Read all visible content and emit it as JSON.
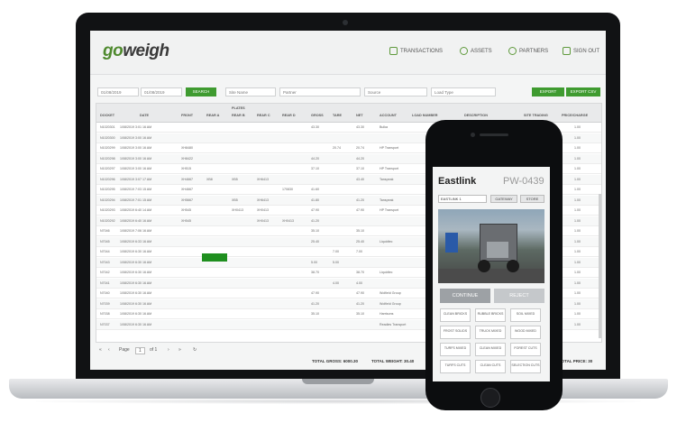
{
  "app": {
    "logo_go": "go",
    "logo_weigh": "weigh",
    "nav": [
      {
        "label": "TRANSACTIONS",
        "icon": "chart-icon"
      },
      {
        "label": "ASSETS",
        "icon": "assets-icon"
      },
      {
        "label": "PARTNERS",
        "icon": "partners-icon"
      },
      {
        "label": "SIGN OUT",
        "icon": "signout-icon"
      }
    ]
  },
  "filters": {
    "date_from": "01/08/2019",
    "date_to": "01/08/2019",
    "search_button": "SEARCH",
    "select1": "Site Name",
    "select2": "Partner",
    "select3": "Source",
    "select4": "Load Type",
    "export_button": "EXPORT",
    "export_csv_button": "EXPORT CSV"
  },
  "table": {
    "group_header": "PLATES",
    "columns": [
      "DOCKET",
      "DATE",
      "FRONT",
      "REAR A",
      "REAR B",
      "REAR C",
      "REAR D",
      "GROSS",
      "TARE",
      "NET",
      "ACCOUNT",
      "LOAD NUMBER",
      "DESCRIPTION",
      "SITE TRADING",
      "PRICE/CHARGE"
    ],
    "rows": [
      [
        "N1020301",
        "1/08/2019 3:01 16 AM",
        "",
        "",
        "",
        "",
        "",
        "43.30",
        "",
        "43.30",
        "Bulka",
        "",
        "",
        "",
        "1.00"
      ],
      [
        "N1020300",
        "1/08/2019 3:00 16 AM",
        "",
        "",
        "",
        "",
        "",
        "",
        "",
        "",
        "",
        "",
        "",
        "",
        "1.00"
      ],
      [
        "N1020299",
        "1/08/2019 3:00 16 AM",
        "XH8480",
        "",
        "",
        "",
        "",
        "",
        "20.74",
        "20.74",
        "HP Transport",
        "",
        "",
        "",
        "1.00"
      ],
      [
        "N1020298",
        "1/08/2019 3:00 16 AM",
        "XH8422",
        "",
        "",
        "",
        "",
        "44.20",
        "",
        "44.20",
        "",
        "",
        "",
        "",
        "1.00"
      ],
      [
        "N1020297",
        "1/08/2019 3:00 16 AM",
        "XH515",
        "",
        "",
        "",
        "",
        "37.10",
        "",
        "37.10",
        "HP Transport",
        "",
        "",
        "",
        "1.00"
      ],
      [
        "N1020296",
        "1/08/2019 3:07 17 AM",
        "XH4667",
        "XB8",
        "XB5",
        "XH6413",
        "",
        "",
        "",
        "43.40",
        "Tanspeak",
        "",
        "",
        "",
        "1.00"
      ],
      [
        "N1020295",
        "1/08/2019 7:03 15 AM",
        "XH4667",
        "",
        "",
        "",
        "170830",
        "41.60",
        "",
        "",
        "",
        "",
        "",
        "",
        "1.00"
      ],
      [
        "N1020294",
        "1/08/2019 7:01 15 AM",
        "XH5667",
        "",
        "XB5",
        "XH6413",
        "",
        "41.80",
        "",
        "41.20",
        "Tanspeak",
        "",
        "",
        "",
        "1.00"
      ],
      [
        "N1020293",
        "1/08/2019 6:40 14 AM",
        "XH545",
        "",
        "XH0413",
        "XH0413",
        "",
        "47.90",
        "",
        "47.90",
        "HP Transport",
        "",
        "",
        "",
        "1.00"
      ],
      [
        "N1020292",
        "1/08/2019 6:40 16 AM",
        "XH545",
        "",
        "",
        "XH0413",
        "XH0413",
        "41.20",
        "",
        "",
        "",
        "",
        "",
        "",
        "1.00"
      ],
      [
        "N7046",
        "1/08/2019 7:06 16 AM",
        "",
        "",
        "",
        "",
        "",
        "35.10",
        "",
        "35.10",
        "",
        "",
        "",
        "",
        "1.00"
      ],
      [
        "N7045",
        "1/08/2019 6:33 16 AM",
        "",
        "",
        "",
        "",
        "",
        "25.40",
        "",
        "25.40",
        "Liquidtec",
        "",
        "",
        "",
        "1.00"
      ],
      [
        "N7044",
        "1/08/2019 6:30 16 AM",
        "",
        "",
        "",
        "",
        "",
        "",
        "7.00",
        "7.00",
        "",
        "",
        "",
        "",
        "1.00"
      ],
      [
        "N7043",
        "1/08/2019 6:30 16 AM",
        "",
        "",
        "",
        "",
        "",
        "5.00",
        "5.00",
        "",
        "",
        "",
        "",
        "",
        "1.00"
      ],
      [
        "N7042",
        "1/08/2019 6:30 16 AM",
        "",
        "",
        "",
        "",
        "",
        "38.70",
        "",
        "38.70",
        "Liquidtec",
        "",
        "",
        "",
        "1.00"
      ],
      [
        "N7041",
        "1/08/2019 6:30 16 AM",
        "",
        "",
        "",
        "",
        "",
        "",
        "4.00",
        "4.00",
        "",
        "",
        "",
        "",
        "1.00"
      ],
      [
        "N7040",
        "1/08/2019 6:30 16 AM",
        "",
        "",
        "",
        "",
        "",
        "47.90",
        "",
        "47.90",
        "Wolfield Group",
        "",
        "",
        "",
        "1.00"
      ],
      [
        "N7039",
        "1/08/2019 6:30 16 AM",
        "",
        "",
        "",
        "",
        "",
        "41.20",
        "",
        "41.20",
        "Wolfield Group",
        "",
        "",
        "",
        "1.00"
      ],
      [
        "N7038",
        "1/08/2019 6:30 16 AM",
        "",
        "",
        "",
        "",
        "",
        "35.10",
        "",
        "35.10",
        "Harrisons",
        "",
        "",
        "",
        "1.00"
      ],
      [
        "N7037",
        "1/08/2019 6:30 16 AM",
        "",
        "",
        "",
        "",
        "",
        "",
        "",
        "",
        "Readies Transport",
        "",
        "",
        "",
        "1.00"
      ]
    ]
  },
  "pager": {
    "page_label": "Page",
    "page_value": "1",
    "of_label": "of 1"
  },
  "totals": {
    "gross": "TOTAL GROSS: 6000.30",
    "tare": "TOTAL WEIGHT: 30.40",
    "price": "TOTAL PRICE: 30"
  },
  "phone": {
    "title": "Eastlink",
    "plate": "PW-0439",
    "select_value": "EASTLINK 1",
    "btn_gateway": "GATEWAY",
    "btn_store": "STORE",
    "action_continue": "CONTINUE",
    "action_reject": "REJECT",
    "grid": [
      "CLEAN BRICKS",
      "RUBBLE BRICKS",
      "SOIL MIXED",
      "FROST SOLIDS",
      "TRUCK MIXED",
      "WOOD MIXED",
      "TURFS MIXED",
      "CLEAN MIXED",
      "FOREST CUTS",
      "TURFS CUTS",
      "CLEAN CUTS",
      "SELECTION CUTS"
    ]
  }
}
